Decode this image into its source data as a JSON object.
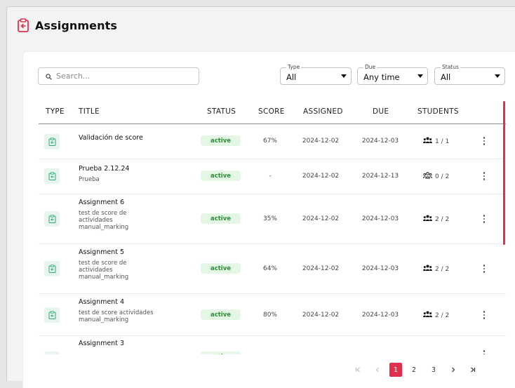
{
  "header": {
    "title": "Assignments",
    "icon": "clipboard-arrow-icon",
    "accent": "#e0304e"
  },
  "search": {
    "placeholder": "Search..."
  },
  "filters": {
    "type": {
      "label": "Type",
      "value": "All"
    },
    "due": {
      "label": "Due",
      "value": "Any time"
    },
    "status": {
      "label": "Status",
      "value": "All"
    }
  },
  "table": {
    "columns": [
      "TYPE",
      "TITLE",
      "STATUS",
      "SCORE",
      "ASSIGNED",
      "DUE",
      "STUDENTS"
    ],
    "rows": [
      {
        "title": "Validación de score",
        "subtitle": "",
        "status": "active",
        "score": "67%",
        "assigned": "2024-12-02",
        "due": "2024-12-03",
        "students": "1 / 1",
        "students_icon": "group-filled-icon"
      },
      {
        "title": "Prueba 2.12.24",
        "subtitle": "Prueba",
        "status": "active",
        "score": "-",
        "assigned": "2024-12-02",
        "due": "2024-12-13",
        "students": "0 / 2",
        "students_icon": "group-outline-icon"
      },
      {
        "title": "Assignment 6",
        "subtitle": "test de score de actividades manual_marking",
        "status": "active",
        "score": "35%",
        "assigned": "2024-12-02",
        "due": "2024-12-03",
        "students": "2 / 2",
        "students_icon": "group-filled-icon"
      },
      {
        "title": "Assignment 5",
        "subtitle": "test de score de actividades manual_marking",
        "status": "active",
        "score": "64%",
        "assigned": "2024-12-02",
        "due": "2024-12-03",
        "students": "2 / 2",
        "students_icon": "group-filled-icon"
      },
      {
        "title": "Assignment 4",
        "subtitle": "test de score actividades manual_marking",
        "status": "active",
        "score": "80%",
        "assigned": "2024-12-02",
        "due": "2024-12-03",
        "students": "2 / 2",
        "students_icon": "group-filled-icon"
      },
      {
        "title": "Assignment 3",
        "subtitle": "",
        "status": "active",
        "score": "",
        "assigned": "",
        "due": "",
        "students": "",
        "students_icon": "group-filled-icon"
      }
    ]
  },
  "pagination": {
    "pages": [
      "1",
      "2",
      "3"
    ],
    "current": "1"
  },
  "colors": {
    "accent": "#e0304e",
    "badge_bg": "#e4f6e4",
    "badge_text": "#2e8b35",
    "type_icon_bg": "#e6f5ee",
    "type_icon": "#3aa27a"
  }
}
